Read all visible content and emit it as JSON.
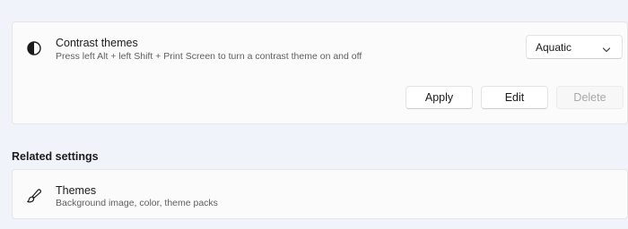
{
  "contrast_themes": {
    "icon": "contrast-icon",
    "title": "Contrast themes",
    "description": "Press left Alt + left Shift + Print Screen to turn a contrast theme on and off",
    "dropdown": {
      "selected": "Aquatic",
      "icon": "chevron-down-icon"
    },
    "buttons": {
      "apply": "Apply",
      "edit": "Edit",
      "delete": "Delete"
    }
  },
  "related_settings": {
    "heading": "Related settings",
    "items": [
      {
        "icon": "brush-icon",
        "title": "Themes",
        "description": "Background image, color, theme packs"
      }
    ]
  },
  "colors": {
    "background": "#f0f3f9",
    "card": "#fbfbfb",
    "disabled_text": "#a8a8a8"
  }
}
